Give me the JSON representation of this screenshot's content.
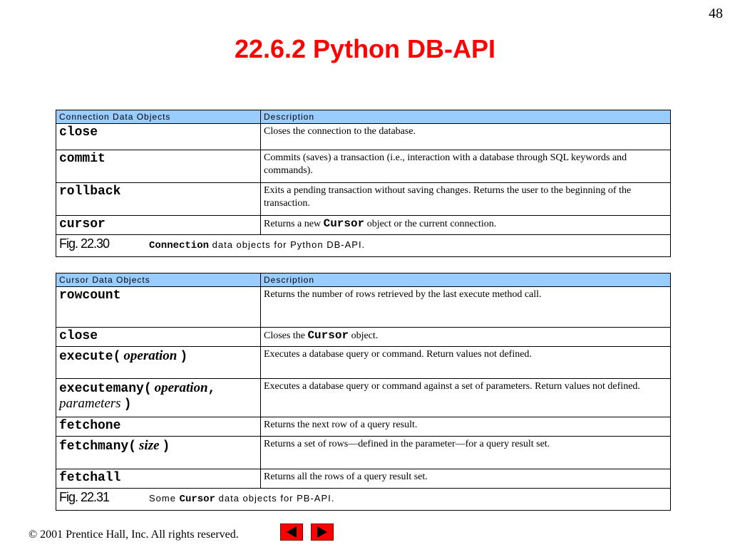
{
  "page_number": "48",
  "title": "22.6.2 Python DB-API",
  "table1": {
    "headers": [
      "Connection Data Objects",
      "Description"
    ],
    "rows": [
      {
        "name": "close",
        "desc": "Closes the connection to the database."
      },
      {
        "name": "commit",
        "desc": "Commits (saves) a transaction (i.e., interaction with a database through SQL keywords and commands)."
      },
      {
        "name": "rollback",
        "desc": "Exits a pending transaction without saving changes. Returns the user to the beginning of the transaction."
      },
      {
        "name": "cursor",
        "desc_pre": "Returns a new ",
        "desc_code": "Cursor",
        "desc_post": " object or the current connection."
      }
    ],
    "caption_label": "Fig. 22.30",
    "caption_code": "Connection",
    "caption_text": " data objects for Python DB-API."
  },
  "table2": {
    "headers": [
      "Cursor Data Objects",
      "Description"
    ],
    "rows": [
      {
        "name": "rowcount",
        "desc": "Returns the number of rows retrieved by the last execute method call."
      },
      {
        "name": "close",
        "desc_pre": "Closes the ",
        "desc_code": "Cursor",
        "desc_post": " object."
      },
      {
        "name": "execute(",
        "arg": "operation",
        "close": ")",
        "desc": "Executes a database query or command. Return values not defined."
      },
      {
        "name": "executemany(",
        "arg": "operation",
        "comma": ",",
        "arg2": "parameters",
        "close": ")",
        "desc": "Executes a database query or command against a set of parameters. Return values not defined."
      },
      {
        "name": "fetchone",
        "desc": "Returns the next row of a query result."
      },
      {
        "name": "fetchmany(",
        "arg": "size",
        "close": ")",
        "desc": "Returns a set of rows—defined in the parameter—for a query result set."
      },
      {
        "name": "fetchall",
        "desc": "Returns all the rows of a query result set."
      }
    ],
    "caption_label": "Fig. 22.31",
    "caption_pre": "Some ",
    "caption_code": "Cursor",
    "caption_text": " data objects for PB-API."
  },
  "footer": "© 2001 Prentice Hall, Inc.  All rights reserved.",
  "nav": {
    "prev_icon": "left-arrow-icon",
    "next_icon": "right-arrow-icon",
    "color": "#ff0000"
  },
  "colors": {
    "title": "#ff0000",
    "header_bg": "#99ccff"
  }
}
